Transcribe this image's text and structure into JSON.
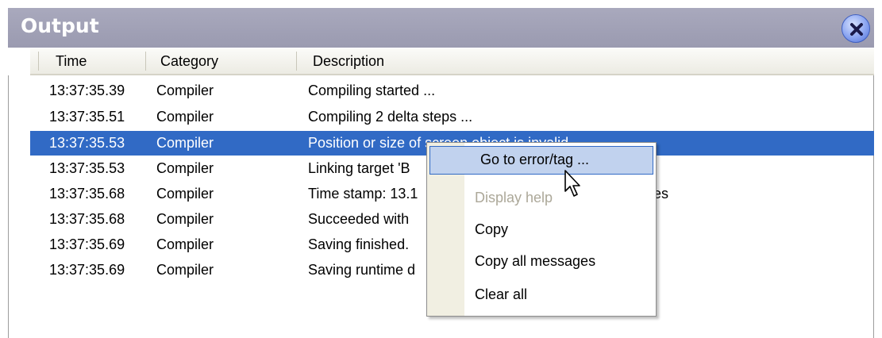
{
  "panel": {
    "title": "Output",
    "close_icon": "close-x-icon"
  },
  "columns": [
    "Time",
    "Category",
    "Description"
  ],
  "rows": [
    {
      "time": "13:37:35.39",
      "category": "Compiler",
      "description": "Compiling started ..."
    },
    {
      "time": "13:37:35.51",
      "category": "Compiler",
      "description": "Compiling 2 delta steps ..."
    },
    {
      "time": "13:37:35.53",
      "category": "Compiler",
      "description": "Position or size of screen object is invalid."
    },
    {
      "time": "13:37:35.53",
      "category": "Compiler",
      "description": "Linking target 'B"
    },
    {
      "time": "13:37:35.68",
      "category": "Compiler",
      "description": "Time stamp: 13.1"
    },
    {
      "time": "13:37:35.68",
      "category": "Compiler",
      "description": "Succeeded with"
    },
    {
      "time": "13:37:35.69",
      "category": "Compiler",
      "description": "Saving finished."
    },
    {
      "time": "13:37:35.69",
      "category": "Compiler",
      "description": "Saving runtime d"
    }
  ],
  "row5_trailing_text": "es",
  "selected_row_index": 2,
  "context_menu": {
    "items": [
      {
        "label": "Go to error/tag ...",
        "state": "hover"
      },
      {
        "label": "Display help",
        "state": "disabled"
      },
      {
        "label": "Copy",
        "state": "normal"
      },
      {
        "label": "Copy all messages",
        "state": "normal"
      },
      {
        "label": "Clear all",
        "state": "normal"
      }
    ]
  },
  "colors": {
    "titlebar": "#a9a9bd",
    "selection": "#316ac5",
    "menu_hover": "#c1d2ee"
  }
}
